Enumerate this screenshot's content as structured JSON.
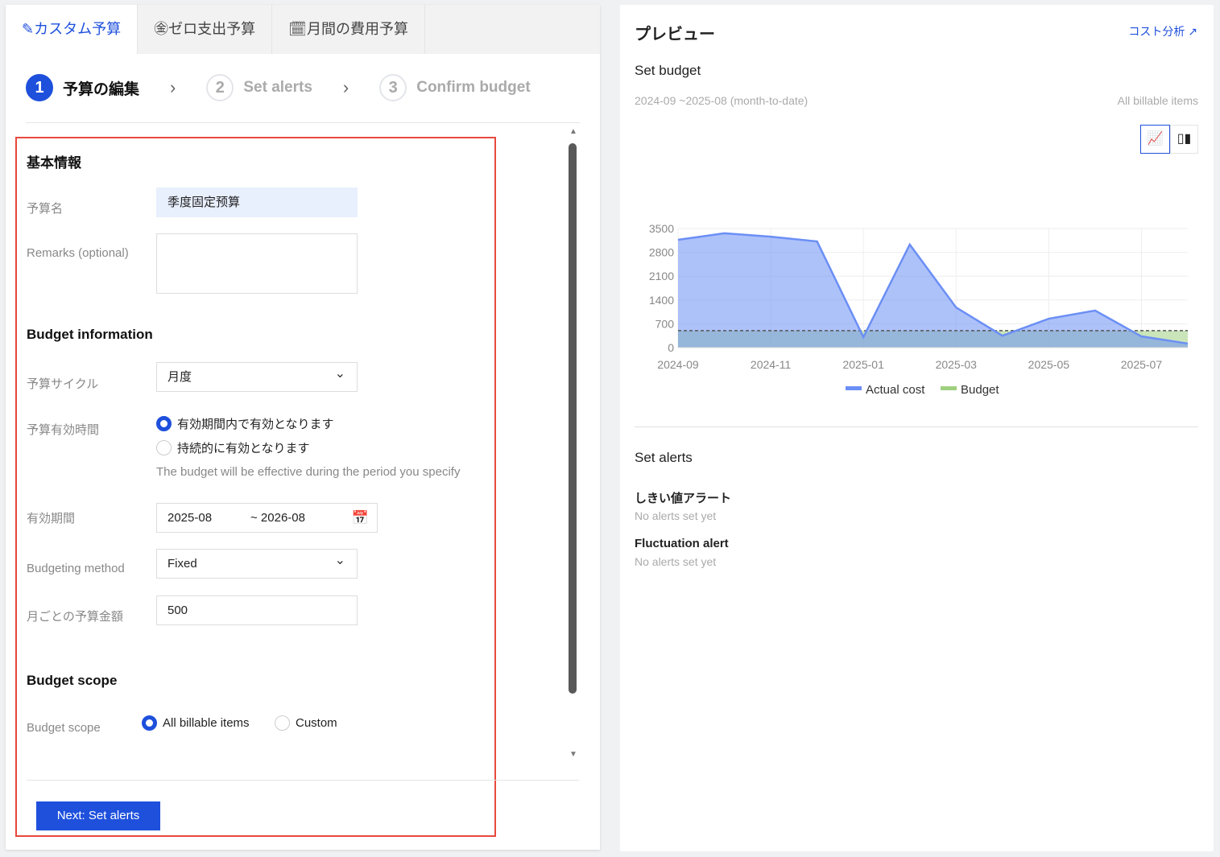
{
  "tabs": [
    {
      "label": "カスタム予算",
      "icon": "pencil-icon"
    },
    {
      "label": "ゼロ支出予算",
      "icon": "yen-icon"
    },
    {
      "label": "月間の費用予算",
      "icon": "calendar-icon"
    }
  ],
  "steps": [
    {
      "num": "1",
      "label": "予算の編集"
    },
    {
      "num": "2",
      "label": "Set alerts"
    },
    {
      "num": "3",
      "label": "Confirm budget"
    }
  ],
  "form": {
    "basic_title": "基本情報",
    "name_label": "予算名",
    "name_value": "季度固定预算",
    "remarks_label": "Remarks (optional)",
    "budget_info_title": "Budget information",
    "cycle_label": "予算サイクル",
    "cycle_value": "月度",
    "validity_label": "予算有効時間",
    "validity_opt1": "有効期間内で有効となります",
    "validity_opt2": "持続的に有効となります",
    "validity_hint": "The budget will be effective during the period you specify",
    "period_label": "有効期間",
    "period_start": "2025-08",
    "period_end": "~ 2026-08",
    "method_label": "Budgeting method",
    "method_value": "Fixed",
    "amount_label": "月ごとの予算金額",
    "amount_value": "500",
    "scope_title": "Budget scope",
    "scope_label": "Budget scope",
    "scope_opt1": "All billable items",
    "scope_opt2": "Custom",
    "next_button": "Next: Set alerts"
  },
  "preview": {
    "title": "プレビュー",
    "cost_link": "コスト分析",
    "set_budget": "Set budget",
    "range": "2024-09 ~2025-08 (month-to-date)",
    "scope": "All billable items",
    "set_alerts": "Set alerts",
    "threshold_title": "しきい値アラート",
    "threshold_empty": "No alerts set yet",
    "fluct_title": "Fluctuation alert",
    "fluct_empty": "No alerts set yet"
  },
  "chart_data": {
    "type": "area",
    "x": [
      "2024-09",
      "2024-10",
      "2024-11",
      "2024-12",
      "2025-01",
      "2025-02",
      "2025-03",
      "2025-04",
      "2025-05",
      "2025-06",
      "2025-07",
      "2025-08"
    ],
    "xticks": [
      "2024-09",
      "2024-11",
      "2025-01",
      "2025-03",
      "2025-05",
      "2025-07"
    ],
    "yticks": [
      "0",
      "700",
      "1400",
      "2100",
      "2800",
      "3500"
    ],
    "ylim": [
      0,
      3500
    ],
    "series": [
      {
        "name": "Actual cost",
        "color": "#6b8ff5",
        "values": [
          3170,
          3360,
          3260,
          3120,
          310,
          3030,
          1180,
          350,
          850,
          1090,
          330,
          120
        ]
      },
      {
        "name": "Budget",
        "color": "#9fd07f",
        "values": [
          500,
          500,
          500,
          500,
          500,
          500,
          500,
          500,
          500,
          500,
          500,
          500
        ]
      }
    ],
    "grid": true,
    "legend": "bottom"
  }
}
